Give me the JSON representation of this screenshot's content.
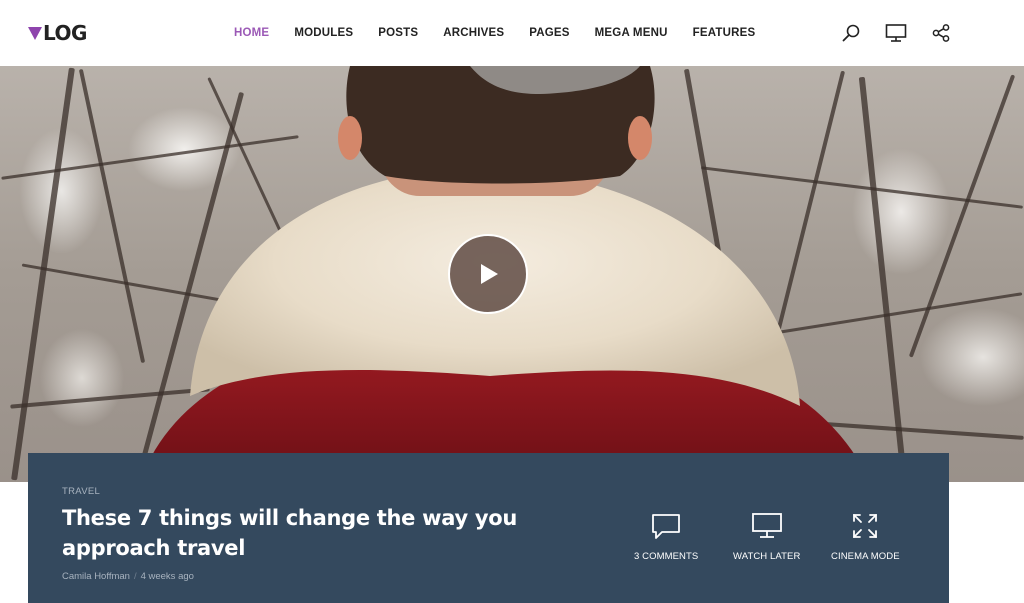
{
  "header": {
    "logo_text": "LOG",
    "nav": [
      {
        "label": "HOME",
        "active": true
      },
      {
        "label": "MODULES"
      },
      {
        "label": "POSTS"
      },
      {
        "label": "ARCHIVES"
      },
      {
        "label": "PAGES"
      },
      {
        "label": "MEGA MENU"
      },
      {
        "label": "FEATURES"
      }
    ],
    "icons": [
      "search-icon",
      "monitor-icon",
      "share-icon"
    ]
  },
  "hero": {
    "play_icon": "play-icon"
  },
  "post": {
    "category": "TRAVEL",
    "title": "These 7 things will change the way you approach travel",
    "author": "Camila Hoffman",
    "separator": "/",
    "date": "4 weeks ago",
    "actions": [
      {
        "icon": "comment-icon",
        "label": "3 COMMENTS"
      },
      {
        "icon": "monitor-icon",
        "label": "WATCH LATER"
      },
      {
        "icon": "expand-icon",
        "label": "CINEMA MODE"
      }
    ]
  },
  "colors": {
    "accent": "#9b59b6",
    "card_bg": "#34495e",
    "text_dark": "#222222"
  }
}
